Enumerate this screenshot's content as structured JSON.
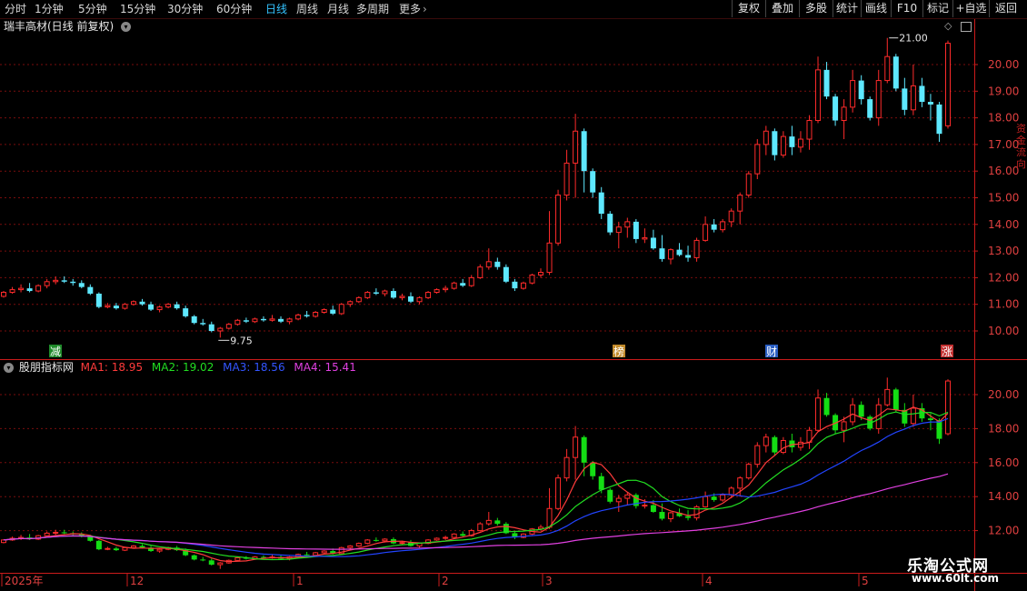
{
  "periods": [
    "分时",
    "1分钟",
    "5分钟",
    "15分钟",
    "30分钟",
    "60分钟",
    "日线",
    "周线",
    "月线",
    "多周期",
    "更多"
  ],
  "active_period": "日线",
  "right_buttons": [
    "复权",
    "叠加",
    "多股",
    "统计",
    "画线",
    "F10",
    "标记",
    "+自选",
    "返回"
  ],
  "main_title": "瑞丰高材(日线 前复权)",
  "indicator_title": "股朋指标网",
  "ma": [
    {
      "label": "MA1: 18.95",
      "color": "#ff3b3b"
    },
    {
      "label": "MA2: 19.02",
      "color": "#22dd22"
    },
    {
      "label": "MA3: 18.56",
      "color": "#2244ff"
    },
    {
      "label": "MA4: 15.41",
      "color": "#e040e0"
    }
  ],
  "price_axis": [
    "21.00",
    "20.00",
    "19.00",
    "18.00",
    "17.00",
    "16.00",
    "15.00",
    "14.00",
    "13.00",
    "12.00",
    "11.00",
    "10.00"
  ],
  "indicator_axis": [
    "20.00",
    "18.00",
    "16.00",
    "14.00",
    "12.00"
  ],
  "high_label": "21.00",
  "low_label": "9.75",
  "markers": [
    {
      "text": "减",
      "bg": "#1f8a2a"
    },
    {
      "text": "榜",
      "bg": "#c28a2a"
    },
    {
      "text": "财",
      "bg": "#2a5ec2"
    },
    {
      "text": "涨",
      "bg": "#c23030"
    }
  ],
  "date_axis": [
    "2025年",
    "12",
    "1",
    "2",
    "3",
    "4",
    "5"
  ],
  "side_text": "资金流向",
  "watermark_title": "乐淘公式网",
  "watermark_url": "www.60lt.com",
  "colors": {
    "up": "#ff2b2b",
    "down_main": "#5ee8ff",
    "down_ind": "#14dd14",
    "grid": "#7a0d0d",
    "axis": "#cc1b1b"
  },
  "chart_data": {
    "type": "candlestick",
    "x_range": [
      "2024-11",
      "2025-05"
    ],
    "ohlc": [
      [
        11.3,
        11.5,
        11.25,
        11.45
      ],
      [
        11.45,
        11.65,
        11.4,
        11.55
      ],
      [
        11.55,
        11.75,
        11.45,
        11.6
      ],
      [
        11.6,
        11.8,
        11.45,
        11.5
      ],
      [
        11.5,
        11.75,
        11.45,
        11.7
      ],
      [
        11.7,
        11.95,
        11.6,
        11.85
      ],
      [
        11.85,
        12.05,
        11.75,
        11.9
      ],
      [
        11.9,
        12.05,
        11.8,
        11.85
      ],
      [
        11.85,
        11.95,
        11.7,
        11.8
      ],
      [
        11.8,
        11.9,
        11.6,
        11.65
      ],
      [
        11.65,
        11.75,
        11.35,
        11.4
      ],
      [
        11.4,
        11.45,
        10.85,
        10.9
      ],
      [
        10.9,
        11.05,
        10.85,
        10.95
      ],
      [
        10.95,
        11.05,
        10.8,
        10.85
      ],
      [
        10.85,
        11.05,
        10.8,
        11.0
      ],
      [
        11.0,
        11.15,
        10.95,
        11.1
      ],
      [
        11.1,
        11.2,
        10.95,
        11.0
      ],
      [
        11.0,
        11.1,
        10.75,
        10.8
      ],
      [
        10.8,
        10.95,
        10.7,
        10.9
      ],
      [
        10.9,
        11.05,
        10.85,
        11.0
      ],
      [
        11.0,
        11.1,
        10.8,
        10.85
      ],
      [
        10.85,
        10.95,
        10.5,
        10.55
      ],
      [
        10.55,
        10.6,
        10.25,
        10.3
      ],
      [
        10.3,
        10.45,
        10.2,
        10.25
      ],
      [
        10.25,
        10.35,
        9.95,
        10.0
      ],
      [
        10.0,
        10.15,
        9.75,
        10.1
      ],
      [
        10.1,
        10.3,
        10.05,
        10.25
      ],
      [
        10.25,
        10.45,
        10.2,
        10.4
      ],
      [
        10.4,
        10.5,
        10.3,
        10.35
      ],
      [
        10.35,
        10.5,
        10.3,
        10.45
      ],
      [
        10.45,
        10.55,
        10.35,
        10.4
      ],
      [
        10.4,
        10.6,
        10.35,
        10.45
      ],
      [
        10.45,
        10.55,
        10.3,
        10.35
      ],
      [
        10.35,
        10.5,
        10.25,
        10.45
      ],
      [
        10.45,
        10.65,
        10.4,
        10.6
      ],
      [
        10.6,
        10.75,
        10.5,
        10.55
      ],
      [
        10.55,
        10.75,
        10.5,
        10.7
      ],
      [
        10.7,
        10.85,
        10.65,
        10.8
      ],
      [
        10.8,
        10.95,
        10.6,
        10.65
      ],
      [
        10.65,
        11.05,
        10.6,
        11.0
      ],
      [
        11.0,
        11.15,
        10.9,
        11.1
      ],
      [
        11.1,
        11.3,
        11.05,
        11.25
      ],
      [
        11.25,
        11.5,
        11.2,
        11.45
      ],
      [
        11.45,
        11.6,
        11.35,
        11.4
      ],
      [
        11.4,
        11.55,
        11.3,
        11.5
      ],
      [
        11.5,
        11.6,
        11.2,
        11.25
      ],
      [
        11.25,
        11.4,
        11.15,
        11.3
      ],
      [
        11.3,
        11.45,
        11.05,
        11.1
      ],
      [
        11.1,
        11.3,
        11.0,
        11.25
      ],
      [
        11.25,
        11.5,
        11.2,
        11.45
      ],
      [
        11.45,
        11.6,
        11.4,
        11.55
      ],
      [
        11.55,
        11.7,
        11.45,
        11.6
      ],
      [
        11.6,
        11.85,
        11.55,
        11.8
      ],
      [
        11.8,
        11.95,
        11.65,
        11.7
      ],
      [
        11.7,
        12.1,
        11.65,
        12.0
      ],
      [
        12.0,
        12.5,
        11.95,
        12.4
      ],
      [
        12.4,
        13.1,
        12.3,
        12.6
      ],
      [
        12.6,
        12.75,
        12.3,
        12.4
      ],
      [
        12.4,
        12.5,
        11.8,
        11.85
      ],
      [
        11.85,
        11.95,
        11.5,
        11.6
      ],
      [
        11.6,
        11.85,
        11.55,
        11.8
      ],
      [
        11.8,
        12.15,
        11.75,
        12.1
      ],
      [
        12.1,
        12.35,
        12.0,
        12.2
      ],
      [
        12.2,
        14.5,
        12.1,
        13.3
      ],
      [
        13.3,
        15.3,
        13.2,
        15.1
      ],
      [
        15.1,
        16.8,
        14.9,
        16.3
      ],
      [
        16.3,
        18.15,
        15.0,
        17.5
      ],
      [
        17.5,
        17.6,
        15.2,
        16.0
      ],
      [
        16.0,
        16.1,
        15.0,
        15.2
      ],
      [
        15.2,
        15.4,
        14.2,
        14.4
      ],
      [
        14.4,
        14.5,
        13.6,
        13.7
      ],
      [
        13.7,
        14.1,
        13.1,
        13.9
      ],
      [
        13.9,
        14.25,
        13.5,
        14.1
      ],
      [
        14.1,
        14.2,
        13.3,
        13.45
      ],
      [
        13.45,
        13.85,
        13.3,
        13.5
      ],
      [
        13.5,
        13.8,
        13.05,
        13.1
      ],
      [
        13.1,
        13.6,
        12.6,
        12.7
      ],
      [
        12.7,
        13.1,
        12.5,
        13.05
      ],
      [
        13.05,
        13.3,
        12.8,
        12.85
      ],
      [
        12.85,
        13.2,
        12.6,
        12.75
      ],
      [
        12.75,
        13.5,
        12.6,
        13.4
      ],
      [
        13.4,
        14.3,
        13.35,
        14.0
      ],
      [
        14.0,
        14.2,
        13.7,
        13.8
      ],
      [
        13.8,
        14.2,
        13.7,
        14.1
      ],
      [
        14.1,
        14.6,
        13.9,
        14.5
      ],
      [
        14.5,
        15.2,
        14.0,
        15.1
      ],
      [
        15.1,
        16.0,
        15.0,
        15.9
      ],
      [
        15.9,
        17.2,
        15.7,
        17.0
      ],
      [
        17.0,
        17.7,
        16.6,
        17.5
      ],
      [
        17.5,
        17.6,
        16.4,
        16.6
      ],
      [
        16.6,
        17.5,
        16.5,
        17.3
      ],
      [
        17.3,
        17.7,
        16.6,
        16.9
      ],
      [
        16.9,
        17.5,
        16.7,
        17.2
      ],
      [
        17.2,
        18.1,
        16.8,
        17.9
      ],
      [
        17.9,
        20.3,
        17.8,
        19.8
      ],
      [
        19.8,
        20.1,
        18.7,
        18.8
      ],
      [
        18.8,
        18.9,
        17.7,
        17.9
      ],
      [
        17.9,
        18.7,
        17.2,
        18.4
      ],
      [
        18.4,
        19.8,
        18.2,
        19.4
      ],
      [
        19.4,
        19.6,
        18.5,
        18.7
      ],
      [
        18.7,
        18.8,
        17.9,
        18.0
      ],
      [
        18.0,
        19.8,
        17.7,
        19.4
      ],
      [
        19.4,
        21.0,
        19.3,
        20.3
      ],
      [
        20.3,
        20.4,
        19.0,
        19.1
      ],
      [
        19.1,
        19.5,
        18.1,
        18.3
      ],
      [
        18.3,
        20.0,
        18.1,
        19.2
      ],
      [
        19.2,
        19.5,
        18.4,
        18.6
      ],
      [
        18.6,
        18.9,
        17.9,
        18.5
      ],
      [
        18.5,
        18.6,
        17.1,
        17.4
      ],
      [
        17.7,
        20.9,
        17.6,
        20.8
      ]
    ],
    "ma": {
      "MA1": 18.95,
      "MA2": 19.02,
      "MA3": 18.56,
      "MA4": 15.41
    },
    "y_range_main": [
      9.5,
      21.5
    ],
    "y_range_indicator": [
      11.0,
      21.5
    ],
    "legend_position": "top-left"
  }
}
